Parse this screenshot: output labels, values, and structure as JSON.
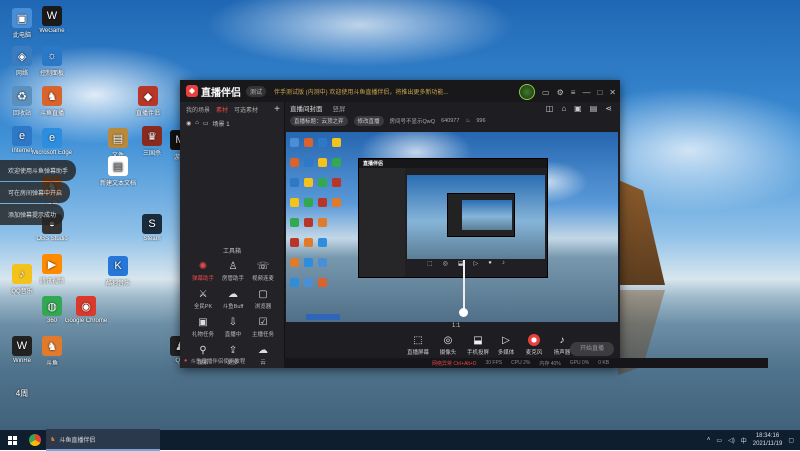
{
  "desktop": {
    "icons": [
      {
        "label": "此电脑",
        "glyph": "▣",
        "color": "#4a8fd6"
      },
      {
        "label": "网络",
        "glyph": "◈",
        "color": "#3a7cc0"
      },
      {
        "label": "回收站",
        "glyph": "♻",
        "color": "#5b8fbd"
      },
      {
        "label": "Internet",
        "glyph": "e",
        "color": "#2e78c8"
      },
      {
        "label": "斗鱼直播",
        "glyph": "♞",
        "color": "#d9632c"
      },
      {
        "label": "WeGame",
        "glyph": "W",
        "color": "#1a1a1a"
      },
      {
        "label": "QQ音乐",
        "glyph": "♪",
        "color": "#f3c21b"
      },
      {
        "label": "WinRe",
        "glyph": "W",
        "color": "#222222"
      },
      {
        "label": "文件",
        "glyph": "▤",
        "color": "#b98a3c"
      },
      {
        "label": "控制面板",
        "glyph": "☼",
        "color": "#2a79c9"
      },
      {
        "label": "Microsoft Edge",
        "glyph": "e",
        "color": "#2d8ee0"
      },
      {
        "label": "腾讯视频",
        "glyph": "▶",
        "color": "#ff8a00"
      },
      {
        "label": "酷狗音乐",
        "glyph": "K",
        "color": "#2776d8"
      },
      {
        "label": "Google Chrome",
        "glyph": "◉",
        "color": "#d93a2b"
      },
      {
        "label": "Steam",
        "glyph": "S",
        "color": "#1a2b3c"
      },
      {
        "label": "OBS Studio",
        "glyph": "●",
        "color": "#333333"
      },
      {
        "label": "新建文本文档",
        "glyph": "▤",
        "color": "#ffffff"
      },
      {
        "label": "三国杀",
        "glyph": "♛",
        "color": "#8a2a1f"
      },
      {
        "label": "游戏",
        "glyph": "M",
        "color": "#111111"
      },
      {
        "label": "QQ",
        "glyph": "♟",
        "color": "#222222"
      },
      {
        "label": "直播伴侣",
        "glyph": "◆",
        "color": "#b8352a"
      },
      {
        "label": "斗鱼",
        "glyph": "♞",
        "color": "#e27a2c"
      },
      {
        "label": "斗鱼",
        "glyph": "♞",
        "color": "#e27a2c"
      },
      {
        "label": "360",
        "glyph": "◍",
        "color": "#32a853"
      }
    ],
    "tips": [
      "欢迎使用斗鱼弹幕助手",
      "可在房间弹幕中开启",
      "添加弹幕提示成功"
    ],
    "corner_label": "4周"
  },
  "app": {
    "title": "直播伴侣",
    "version": "测试",
    "notice": "伴手测试版 (内测中) 欢迎使用斗鱼直播伴侣，将推出更多新功能...",
    "left_tabs": [
      "我的场景",
      "素材",
      "可选素材"
    ],
    "scene_name": "场景 1",
    "tools_title": "工具箱",
    "tools": [
      {
        "label": "弹幕助手",
        "glyph": "✺",
        "active": true
      },
      {
        "label": "房管助手",
        "glyph": "♙",
        "active": false
      },
      {
        "label": "视频连麦",
        "glyph": "☏",
        "active": false
      },
      {
        "label": "全民PK",
        "glyph": "⚔",
        "active": false
      },
      {
        "label": "斗鱼Buff",
        "glyph": "☁",
        "active": false
      },
      {
        "label": "浏览器",
        "glyph": "▢",
        "active": false
      },
      {
        "label": "礼物任务",
        "glyph": "▣",
        "active": false
      },
      {
        "label": "直播中",
        "glyph": "⇩",
        "active": false
      },
      {
        "label": "主播任务",
        "glyph": "☑",
        "active": false
      },
      {
        "label": "搜索",
        "glyph": "⚲",
        "active": false
      },
      {
        "label": "更多",
        "glyph": "⇪",
        "active": false
      },
      {
        "label": "云",
        "glyph": "☁",
        "active": false
      }
    ],
    "footnote": "斗鱼直播伴侣使用教程",
    "main_tabs": [
      "直播间封面",
      "竖屏"
    ],
    "bar": {
      "tag1": "直播标题：云顶之弈",
      "tag2": "修改直播",
      "room": "房间号不显示QwQ",
      "room_id": "640977",
      "fans": "996"
    },
    "inner_title": "直播伴侣",
    "zoom": "1:1",
    "controls": [
      {
        "label": "直播屏幕",
        "glyph": "⬚",
        "rec": false
      },
      {
        "label": "摄像头",
        "glyph": "◎",
        "rec": false
      },
      {
        "label": "手机投屏",
        "glyph": "⬓",
        "rec": false
      },
      {
        "label": "多媒体",
        "glyph": "▷",
        "rec": false
      },
      {
        "label": "麦克风",
        "glyph": "",
        "rec": true
      },
      {
        "label": "扬声器",
        "glyph": "♪",
        "rec": false
      }
    ],
    "start_label": "开始直播",
    "status": {
      "warn": "网络异常 Ctrl+Alt+D",
      "fps": "30 FPS",
      "cpu": "CPU 2%",
      "mem": "内存 40%",
      "gpu": "GPU 0%",
      "net": "0 KB"
    }
  },
  "taskbar": {
    "app_label": "斗鱼直播伴侣",
    "time": "18:34:16",
    "date": "2021/11/19"
  }
}
